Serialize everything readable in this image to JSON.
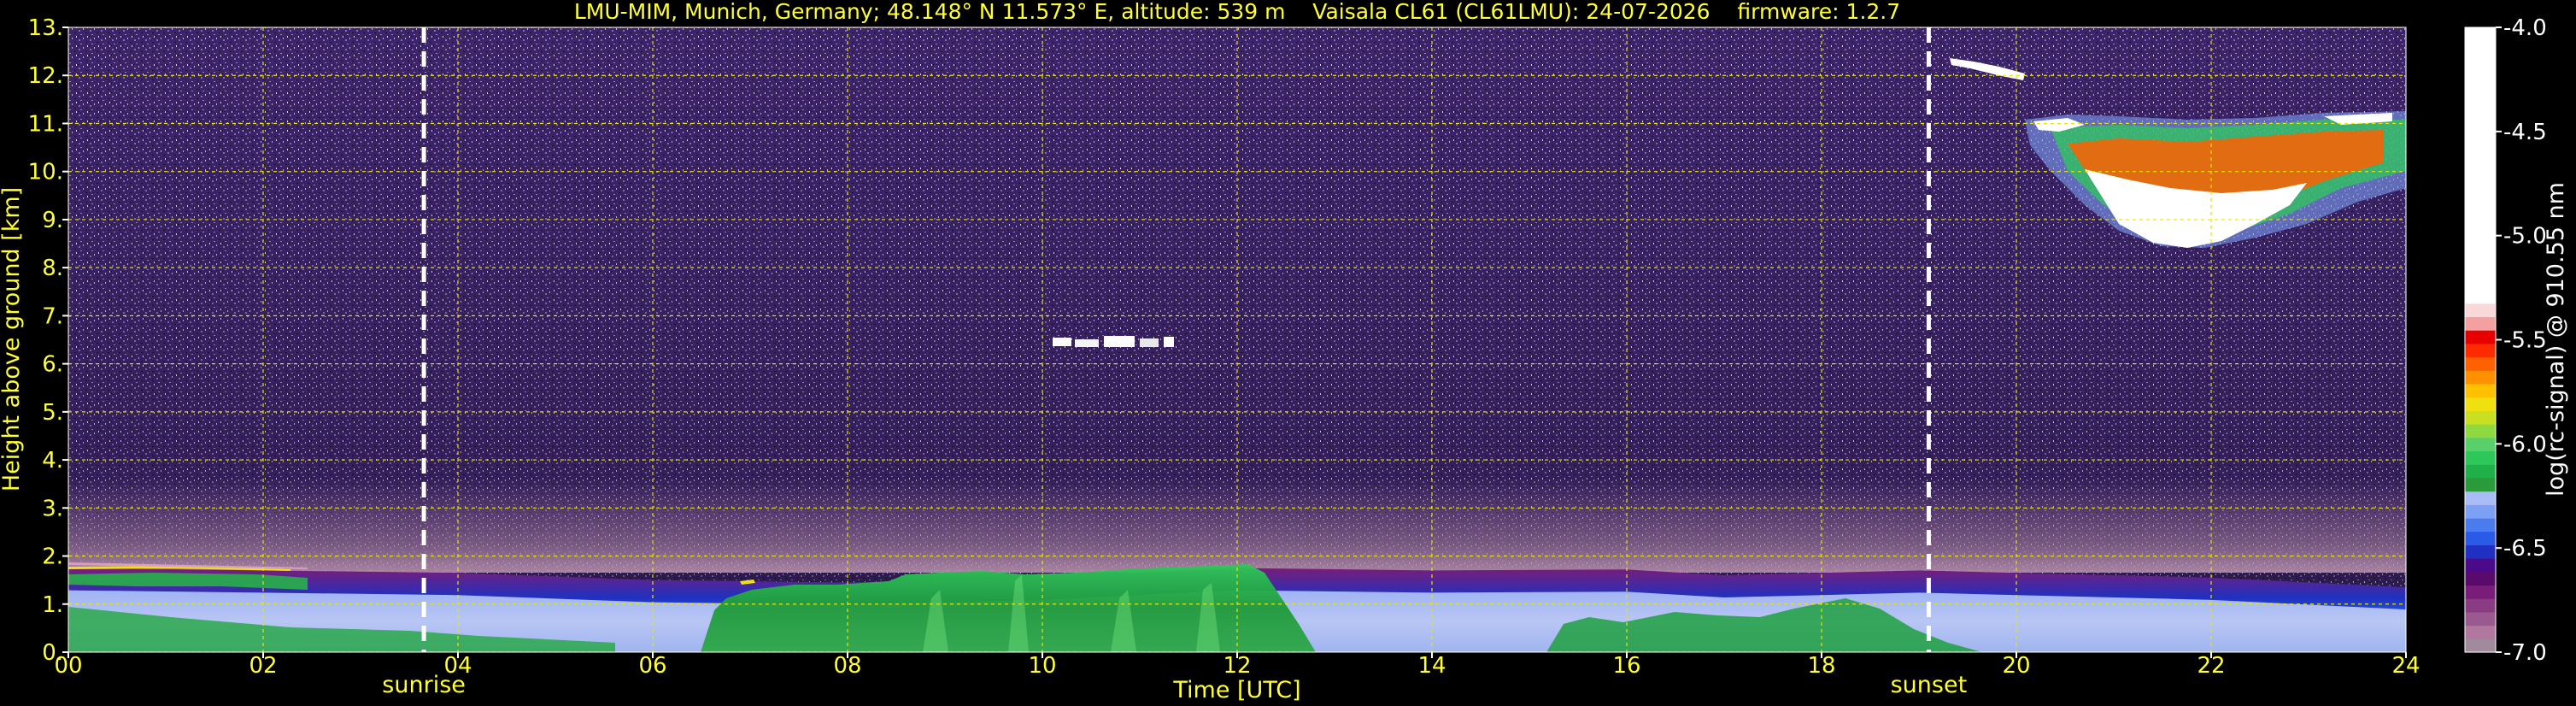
{
  "chart_data": {
    "type": "heatmap",
    "title": "LMU-MIM, Munich, Germany; 48.148° N 11.573° E, altitude: 539 m    Vaisala CL61 (CL61LMU): 24-07-2026    firmware: 1.2.7",
    "xlabel": "Time [UTC]",
    "ylabel": "Height above ground [km]",
    "colorbar_label": "log(rc-signal) @ 910.55 nm",
    "xlim": [
      0,
      24
    ],
    "ylim": [
      0,
      13
    ],
    "x_ticks": [
      0,
      2,
      4,
      6,
      8,
      10,
      12,
      14,
      16,
      18,
      20,
      22,
      24
    ],
    "x_tick_labels": [
      "00",
      "02",
      "04",
      "06",
      "08",
      "10",
      "12",
      "14",
      "16",
      "18",
      "20",
      "22",
      "24"
    ],
    "y_ticks": [
      0,
      1,
      2,
      3,
      4,
      5,
      6,
      7,
      8,
      9,
      10,
      11,
      12,
      13
    ],
    "y_tick_labels": [
      "0.",
      "1.",
      "2.",
      "3.",
      "4.",
      "5.",
      "6.",
      "7.",
      "8.",
      "9.",
      "10.",
      "11.",
      "12.",
      "13."
    ],
    "grid": true,
    "colorbar": {
      "range": [
        -7.0,
        -4.0
      ],
      "ticks": [
        -4.0,
        -4.5,
        -5.0,
        -5.5,
        -6.0,
        -6.5,
        -7.0
      ],
      "tick_labels": [
        "-4.0",
        "-4.5",
        "-5.0",
        "-5.5",
        "-6.0",
        "-6.5",
        "-7.0"
      ],
      "colors": [
        "#a08a9c",
        "#b0789f",
        "#9a5a8f",
        "#8a3c82",
        "#7a1d78",
        "#5a0a6a",
        "#4a0a8a",
        "#2030c0",
        "#2a5ae8",
        "#4a7cf0",
        "#7ea0f4",
        "#a9bcf6",
        "#2a9a3a",
        "#1fb04a",
        "#2ec85a",
        "#5ad06a",
        "#8ed840",
        "#c8e020",
        "#f0e010",
        "#ffc000",
        "#ff9000",
        "#ff6000",
        "#ff2a00",
        "#e80000",
        "#f4a0a0",
        "#f8d8d8",
        "#ffffff"
      ]
    },
    "markers": [
      {
        "label": "sunrise",
        "x": 3.65
      },
      {
        "label": "sunset",
        "x": 19.1
      }
    ],
    "layers": {
      "boundary_layer_top_km": [
        [
          0,
          1.75
        ],
        [
          2,
          1.7
        ],
        [
          4,
          1.65
        ],
        [
          6,
          1.5
        ],
        [
          8,
          1.45
        ],
        [
          10,
          1.55
        ],
        [
          12,
          1.75
        ],
        [
          14,
          1.7
        ],
        [
          16,
          1.72
        ],
        [
          17,
          1.6
        ],
        [
          18,
          1.65
        ],
        [
          19,
          1.7
        ],
        [
          20,
          1.65
        ],
        [
          22,
          1.55
        ],
        [
          24,
          1.35
        ]
      ],
      "cirrus": {
        "x_range": [
          20.2,
          24
        ],
        "y_range_km": [
          8.4,
          11.2
        ]
      },
      "cirrus_strip": {
        "x_range": [
          19.3,
          20.2
        ],
        "y_range_km": [
          12.0,
          12.5
        ]
      },
      "mid_level_cloud": {
        "x_range": [
          10.1,
          11.4
        ],
        "y_km": 6.45
      }
    }
  }
}
